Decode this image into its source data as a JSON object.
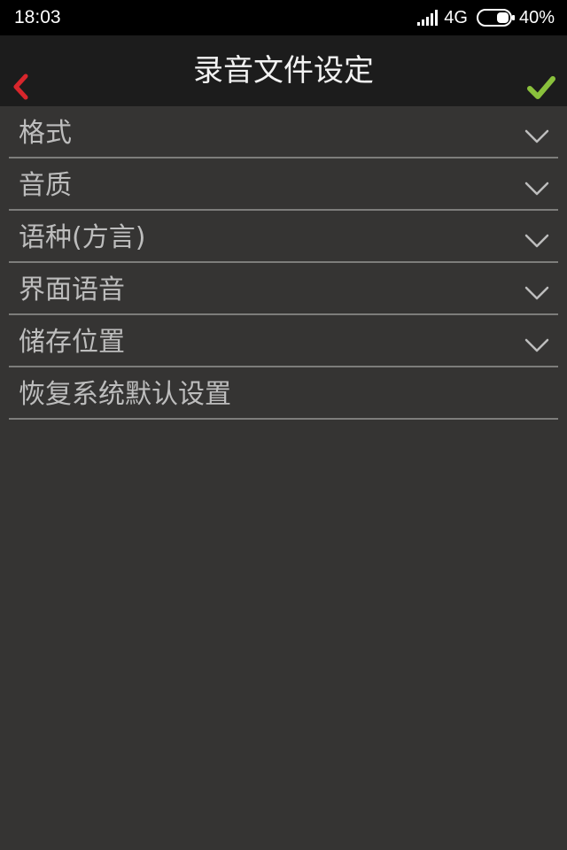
{
  "status_bar": {
    "time": "18:03",
    "network": "4G",
    "battery": "40%",
    "battery_level": 0.4,
    "icons": [
      "signal-icon",
      "battery-icon"
    ]
  },
  "header": {
    "title": "录音文件设定",
    "back_icon": "chevron-left-icon",
    "confirm_icon": "checkmark-icon",
    "back_color": "#d8262c",
    "confirm_color": "#8ac13c"
  },
  "settings": {
    "items": [
      {
        "label": "格式",
        "expandable": true
      },
      {
        "label": "音质",
        "expandable": true
      },
      {
        "label": "语种(方言)",
        "expandable": true
      },
      {
        "label": "界面语音",
        "expandable": true
      },
      {
        "label": "储存位置",
        "expandable": true
      },
      {
        "label": "恢复系统默认设置",
        "expandable": false
      }
    ]
  },
  "colors": {
    "background": "#353433",
    "header_background": "#1c1c1c",
    "status_background": "#000000",
    "text": "#bdbdbd",
    "divider": "#7d7d7b"
  }
}
